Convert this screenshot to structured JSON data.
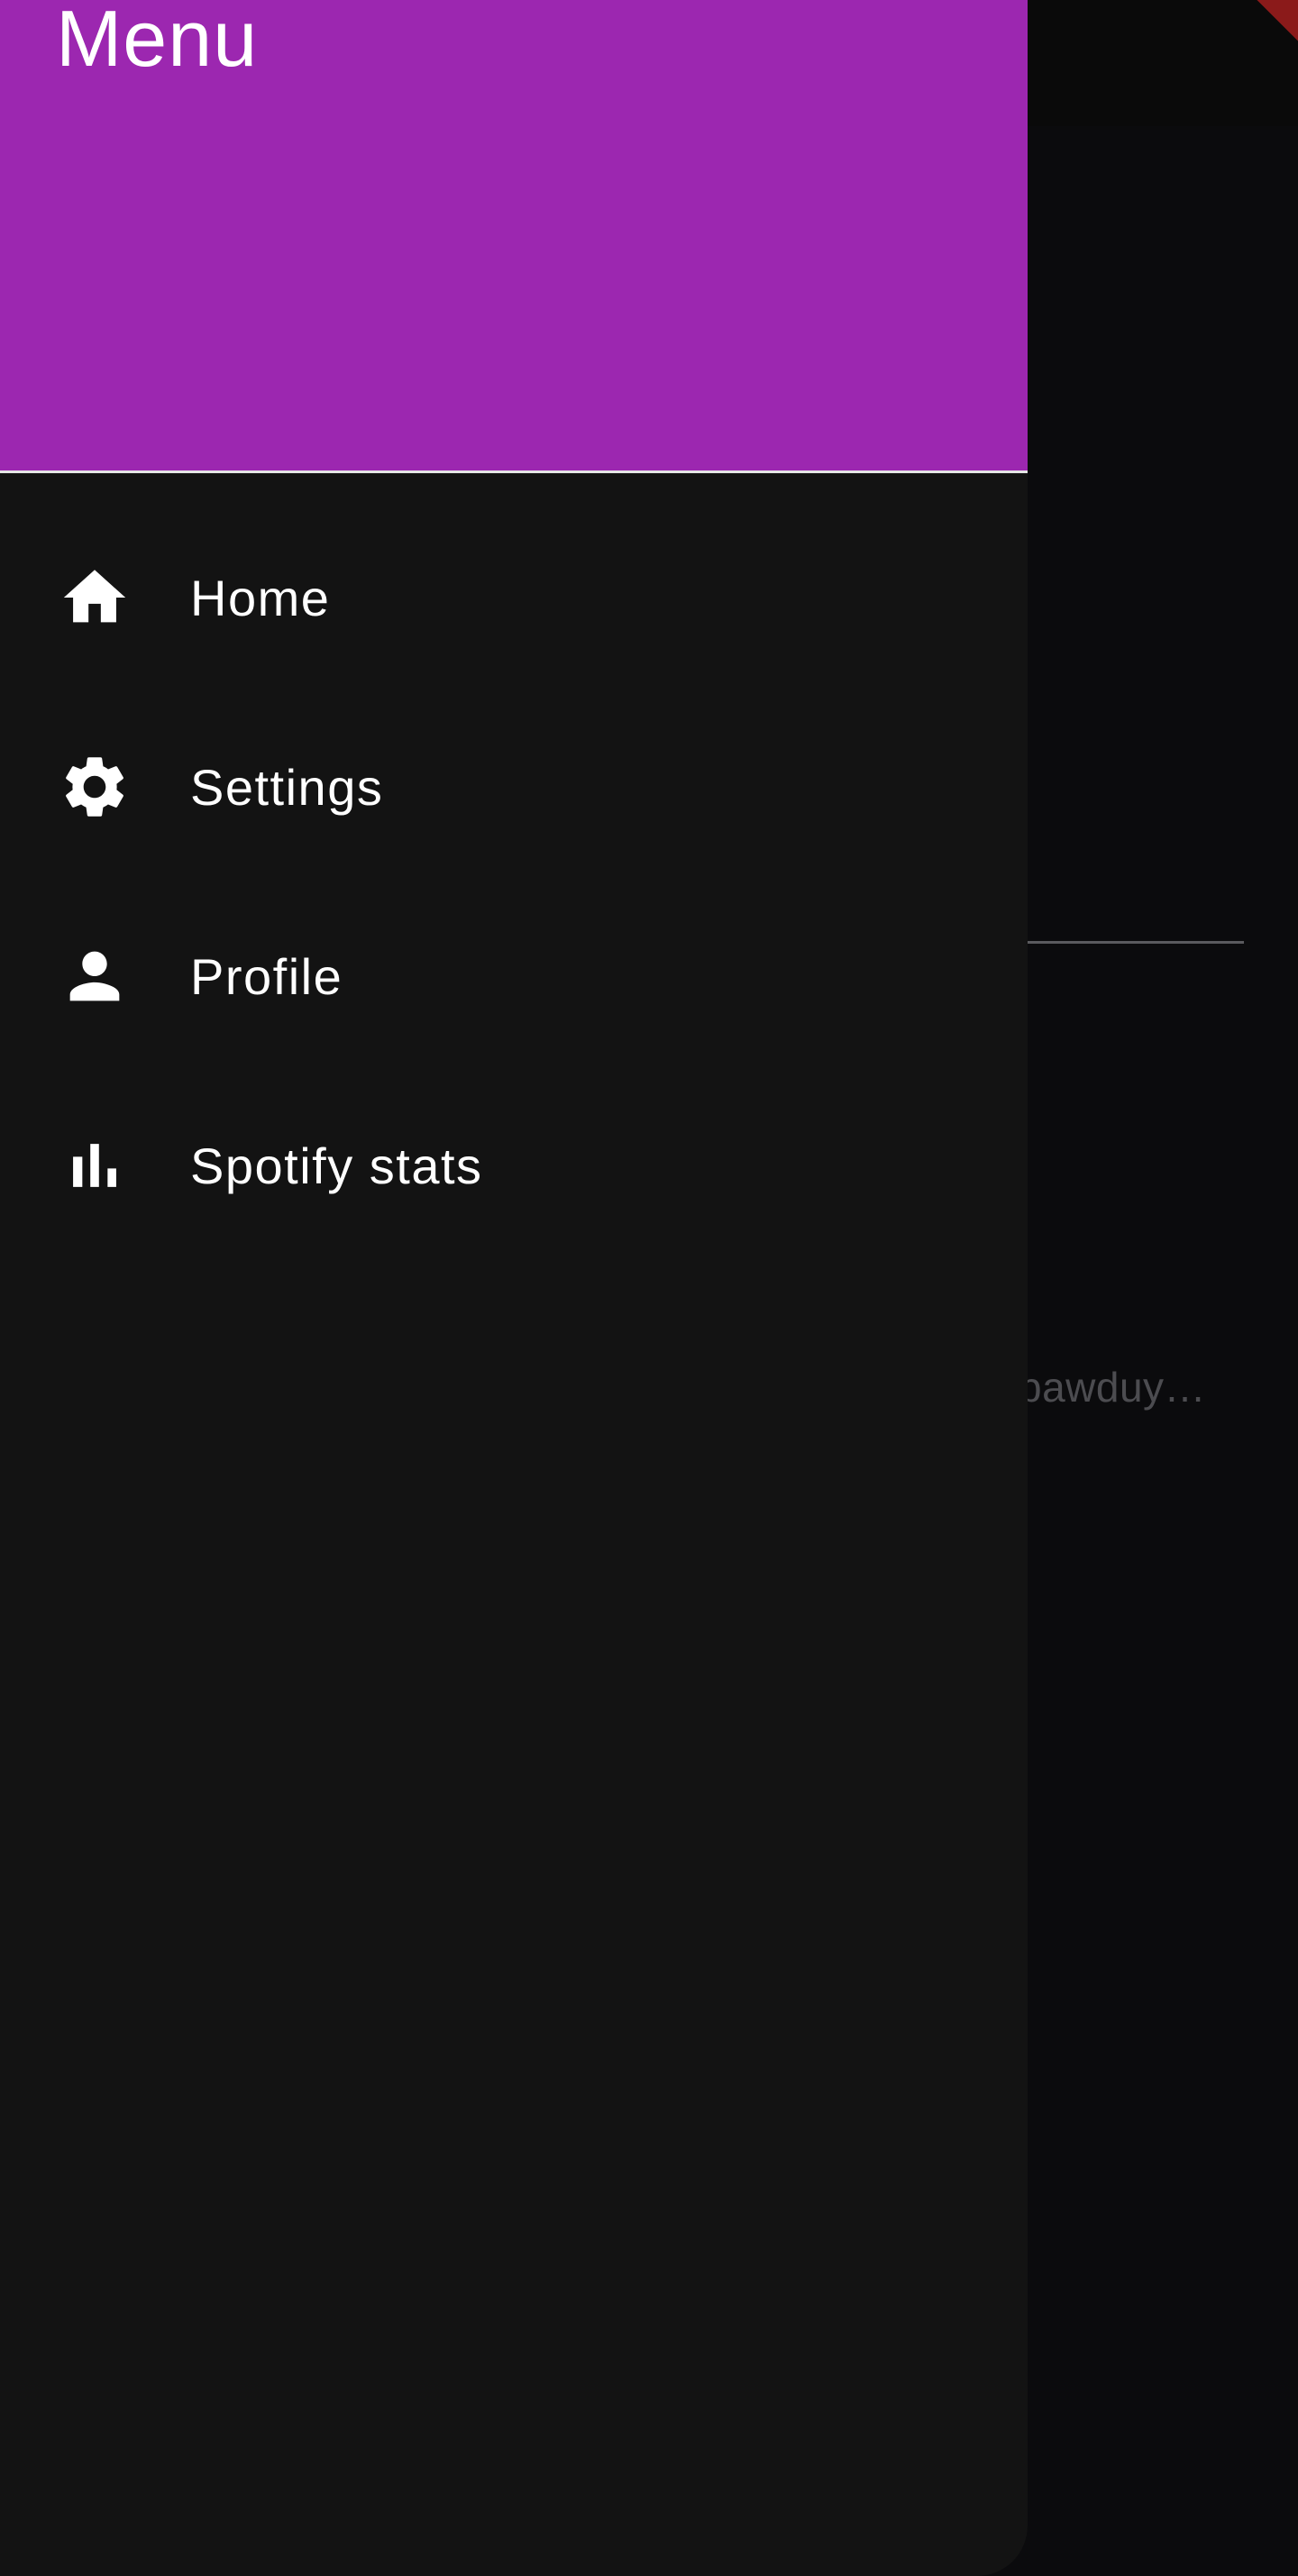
{
  "drawer": {
    "title": "Menu",
    "items": [
      {
        "label": "Home",
        "icon": "home-icon"
      },
      {
        "label": "Settings",
        "icon": "gear-icon"
      },
      {
        "label": "Profile",
        "icon": "person-icon"
      },
      {
        "label": "Spotify stats",
        "icon": "bar-chart-icon"
      }
    ]
  },
  "background": {
    "preview_text": "bawduy…"
  },
  "colors": {
    "header": "#9c27b0",
    "drawer_bg": "#131313",
    "scrim_bg": "#0b0b0d"
  }
}
